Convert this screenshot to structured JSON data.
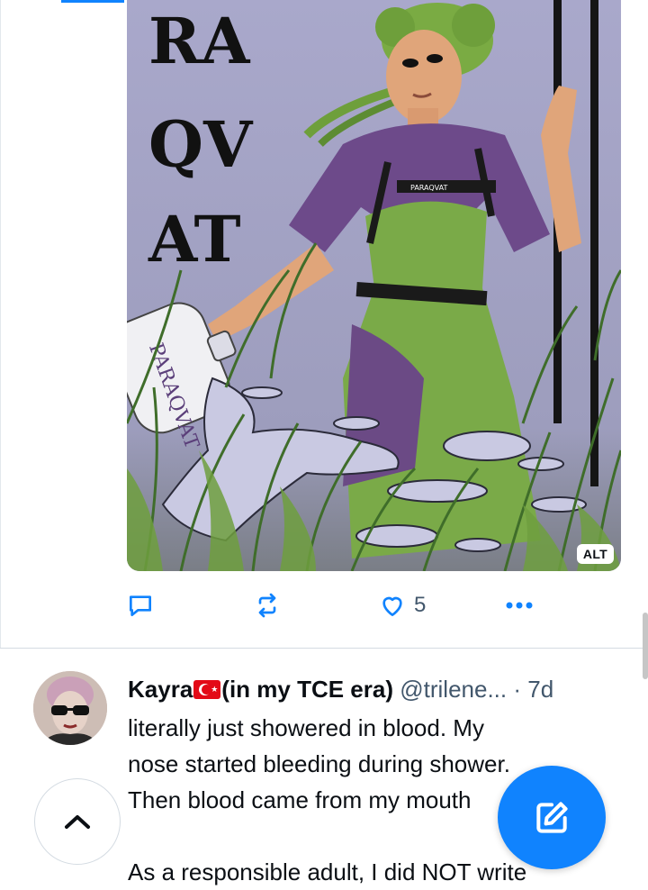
{
  "post_image": {
    "art_title_lines": [
      "RA",
      "QV",
      "AT"
    ],
    "belt_text": "PARAQVAT",
    "bottle_text": "PARAQVAT",
    "alt_badge": "ALT"
  },
  "actions": {
    "reply_icon": "reply-icon",
    "repost_icon": "repost-icon",
    "like_icon": "heart-icon",
    "like_count": "5",
    "more_icon": "more-dots-icon"
  },
  "next_post": {
    "author_name_before_flag": "Kayra",
    "flag": "turkey-flag",
    "author_name_after_flag": "(in my TCE era)",
    "handle": "@trilene...",
    "separator_time": "· 7d",
    "text_lines": [
      "literally just showered in blood. My",
      "nose started bleeding during shower.",
      "Then blood came from my mouth"
    ],
    "text_line_after_gap": "As a responsible adult, I did NOT write"
  },
  "floating": {
    "scroll_top_icon": "chevron-up-icon",
    "compose_icon": "compose-icon"
  },
  "colors": {
    "accent": "#1083fe",
    "muted": "#42576c",
    "divider": "#d4dbe2"
  }
}
